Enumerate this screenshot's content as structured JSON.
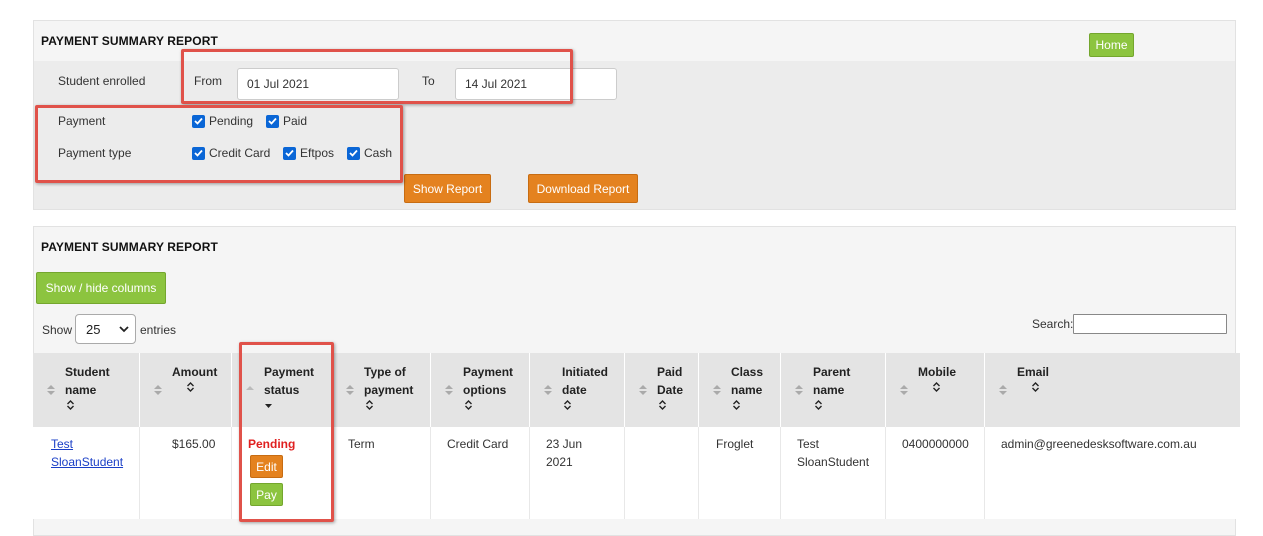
{
  "filter_panel": {
    "title": "PAYMENT SUMMARY REPORT",
    "home_label": "Home",
    "student_enrolled_label": "Student enrolled",
    "from_label": "From",
    "from_value": "01 Jul 2021",
    "to_label": "To",
    "to_value": "14 Jul 2021",
    "payment_label": "Payment",
    "payment_options": [
      "Pending",
      "Paid"
    ],
    "payment_type_label": "Payment type",
    "payment_types": [
      "Credit Card",
      "Eftpos",
      "Cash"
    ],
    "show_report_label": "Show Report",
    "download_report_label": "Download Report"
  },
  "report_panel": {
    "title": "PAYMENT SUMMARY REPORT",
    "show_hide_label": "Show / hide columns",
    "show_label": "Show",
    "entries_value": "25",
    "entries_label": "entries",
    "search_label": "Search:",
    "columns": [
      {
        "line1": "Student",
        "line2": "name"
      },
      {
        "line1": "Amount",
        "line2": ""
      },
      {
        "line1": "Payment",
        "line2": "status"
      },
      {
        "line1": "Type of",
        "line2": "payment"
      },
      {
        "line1": "Payment",
        "line2": "options"
      },
      {
        "line1": "Initiated",
        "line2": "date"
      },
      {
        "line1": "Paid",
        "line2": "Date"
      },
      {
        "line1": "Class",
        "line2": "name"
      },
      {
        "line1": "Parent",
        "line2": "name"
      },
      {
        "line1": "Mobile",
        "line2": ""
      },
      {
        "line1": "Email",
        "line2": ""
      }
    ],
    "rows": [
      {
        "student_name_1": "Test",
        "student_name_2": "SloanStudent",
        "amount": "$165.00",
        "status": "Pending",
        "edit_label": "Edit",
        "pay_label": "Pay",
        "type": "Term",
        "options": "Credit Card",
        "initiated_1": "23 Jun",
        "initiated_2": "2021",
        "paid_date": "",
        "class_name": "Froglet",
        "parent_1": "Test",
        "parent_2": "SloanStudent",
        "mobile": "0400000000",
        "email": "admin@greenedesksoftware.com.au"
      }
    ]
  },
  "colors": {
    "accent_orange": "#e4821f",
    "accent_green": "#8cc43f",
    "highlight_red": "#e0524a",
    "pending_red": "#e02020",
    "checkbox_blue": "#0a66d6"
  }
}
